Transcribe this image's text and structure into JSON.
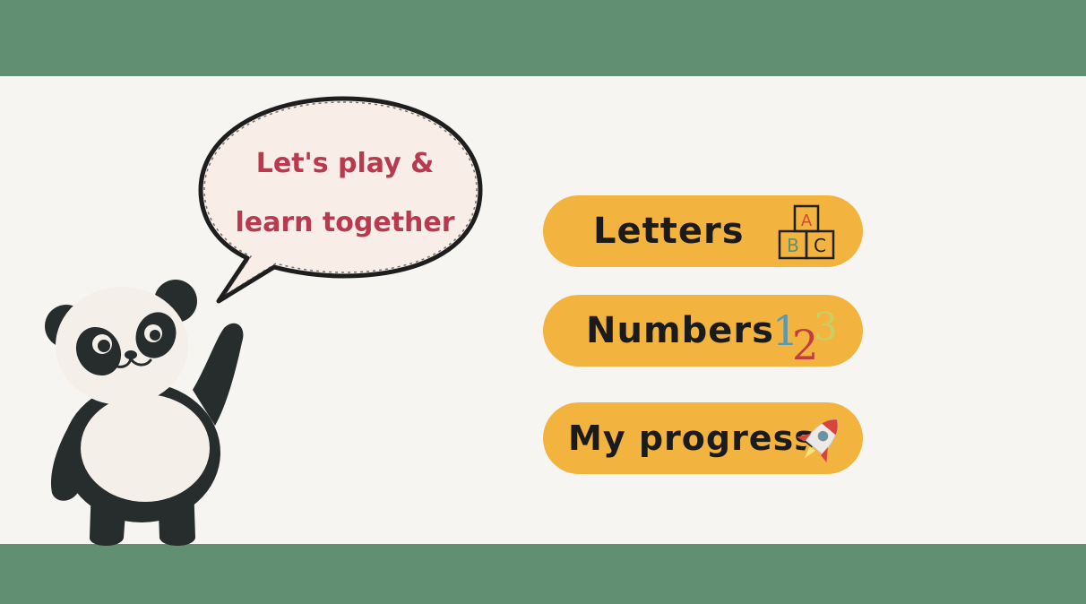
{
  "speech_bubble": {
    "line1": "Let's play &",
    "line2": "learn together"
  },
  "menu": {
    "items": [
      {
        "label": "Letters",
        "icon": "abc-blocks-icon"
      },
      {
        "label": "Numbers",
        "icon": "numbers-123-icon"
      },
      {
        "label": "My progress",
        "icon": "rocket-icon"
      }
    ]
  },
  "icons": {
    "abc": {
      "a": "A",
      "b": "B",
      "c": "C"
    },
    "numbers": {
      "one": "1",
      "two": "2",
      "three": "3"
    }
  },
  "colors": {
    "band": "#608f72",
    "background": "#f7f5f1",
    "button": "#f2b43f",
    "bubble_text": "#b83a4e",
    "button_text": "#1b1b1b"
  }
}
